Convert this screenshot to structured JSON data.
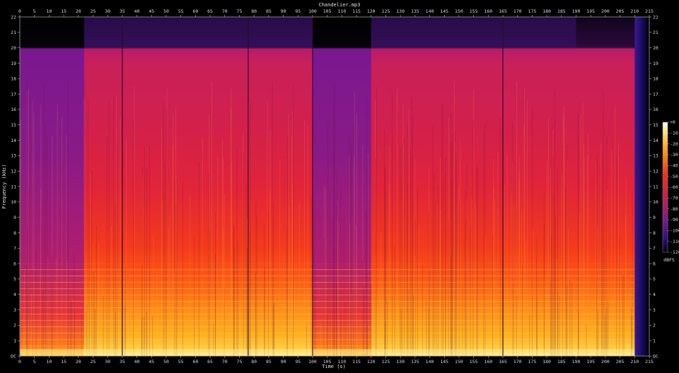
{
  "chart_data": {
    "type": "heatmap",
    "title": "Chandelier.mp3",
    "xlabel": "Time (s)",
    "ylabel": "Frequency (kHz)",
    "xlim": [
      0,
      215
    ],
    "ylim": [
      0,
      22
    ],
    "x_ticks": [
      0,
      5,
      10,
      15,
      20,
      25,
      30,
      35,
      40,
      45,
      50,
      55,
      60,
      65,
      70,
      75,
      80,
      85,
      90,
      95,
      100,
      105,
      110,
      115,
      120,
      125,
      130,
      135,
      140,
      145,
      150,
      155,
      160,
      165,
      170,
      175,
      180,
      185,
      190,
      195,
      200,
      205,
      210,
      215
    ],
    "y_ticks": [
      0,
      1,
      2,
      3,
      4,
      5,
      6,
      7,
      8,
      9,
      10,
      11,
      12,
      13,
      14,
      15,
      16,
      17,
      18,
      19,
      20,
      21,
      22
    ],
    "y_tick_labels": [
      "DC",
      "1",
      "2",
      "3",
      "4",
      "5",
      "6",
      "7",
      "8",
      "9",
      "10",
      "11",
      "12",
      "13",
      "14",
      "15",
      "16",
      "17",
      "18",
      "19",
      "20",
      "21",
      "22"
    ],
    "colorbar": {
      "label": "dBFS",
      "range": [
        -120,
        0
      ],
      "ticks": [
        "+0",
        "-10",
        "-20",
        "-30",
        "-40",
        "-50",
        "-60",
        "-70",
        "-80",
        "-90",
        "-100",
        "-110",
        "-120"
      ]
    },
    "lowpass_cutoff_khz": 20,
    "quiet_sections_s": [
      [
        0,
        22
      ],
      [
        100,
        120
      ]
    ],
    "transient_lines_s": [
      35,
      78,
      100,
      165
    ],
    "fade_out_start_s": 210
  }
}
